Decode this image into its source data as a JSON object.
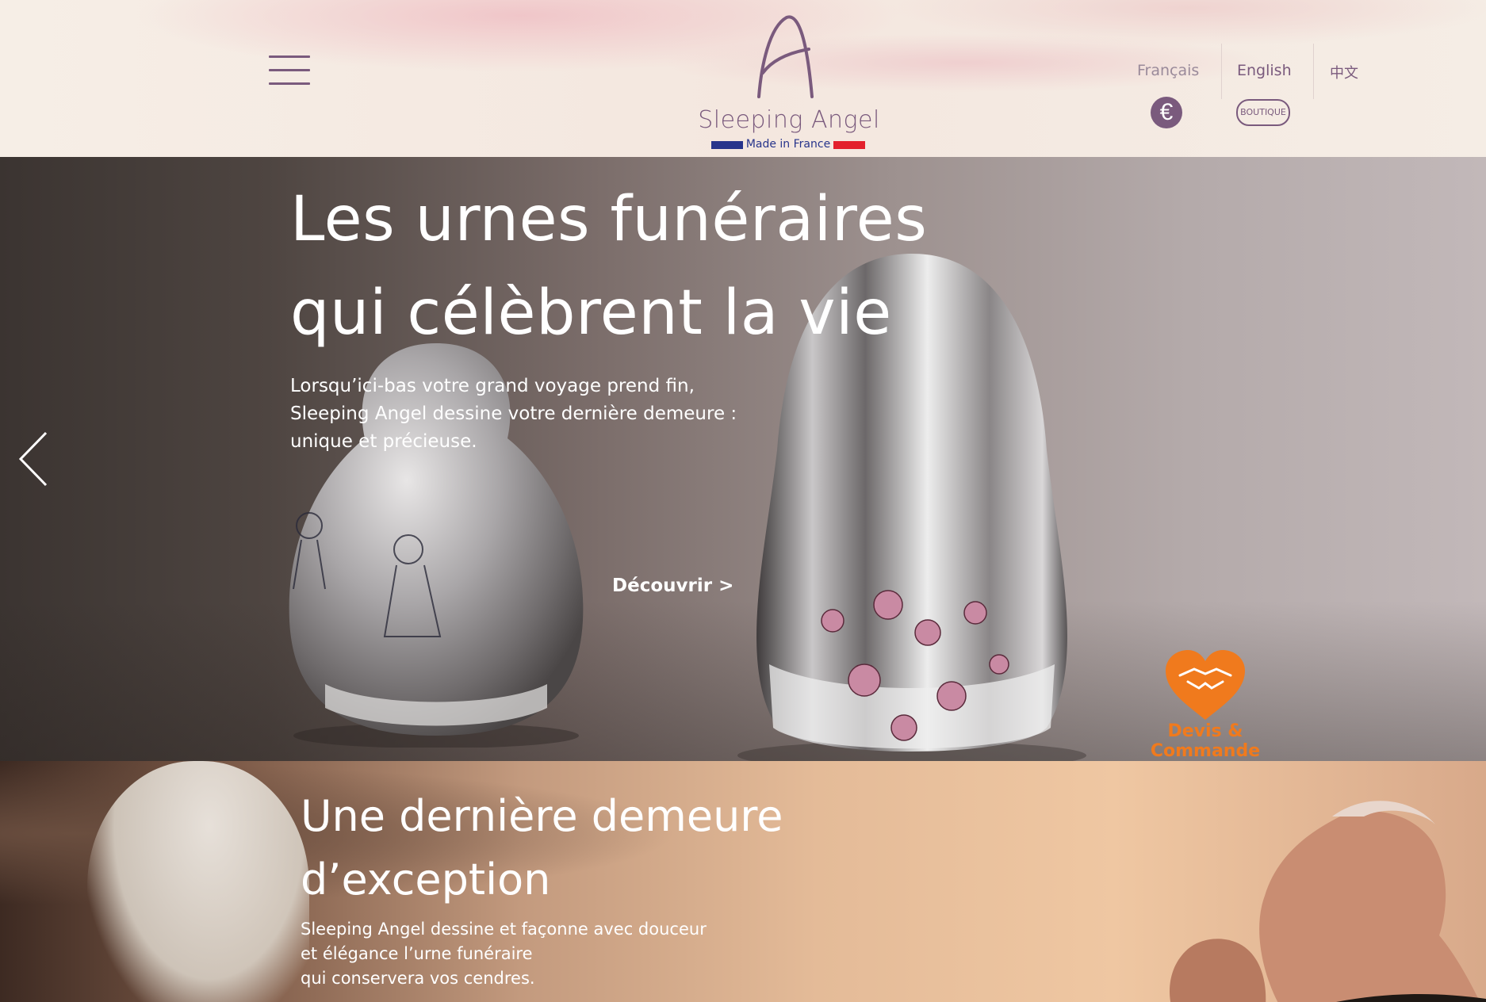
{
  "header": {
    "brand_name": "Sleeping Angel",
    "made_in": "Made in France",
    "languages": [
      "Français",
      "English",
      "中文"
    ],
    "currency_symbol": "€",
    "boutique_label": "BOUTIQUE"
  },
  "hero": {
    "title_line1": "Les urnes funéraires",
    "title_line2": "qui célèbrent la vie",
    "subtitle_line1": "Lorsqu’ici-bas votre grand voyage prend fin,",
    "subtitle_line2": "Sleeping Angel dessine votre dernière demeure :",
    "subtitle_line3": "unique et précieuse.",
    "cta": "Découvrir >",
    "devis_label": "Devis & Commande"
  },
  "section2": {
    "title_line1": "Une dernière demeure",
    "title_line2": "d’exception",
    "text_line1": "Sleeping Angel dessine et façonne avec douceur",
    "text_line2": "et élégance l’urne funéraire",
    "text_line3": "qui conservera vos cendres."
  },
  "colors": {
    "brand_purple": "#7a5a7d",
    "accent_orange": "#f07a1d",
    "flag_blue": "#27348b",
    "flag_red": "#e3202c"
  }
}
